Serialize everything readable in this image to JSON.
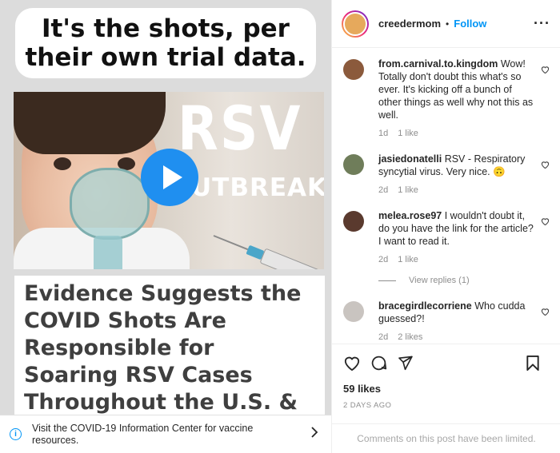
{
  "post": {
    "caption_overlay": "It's the shots, per their own trial data.",
    "image_title_main": "RSV",
    "image_title_sub": "UTBREAK",
    "headline": "Evidence Suggests the COVID Shots Are Responsible for Soaring RSV Cases Throughout the U.S. & Canada",
    "info_banner": "Visit the COVID-19 Information Center for vaccine resources."
  },
  "header": {
    "username": "creedermom",
    "separator": "•",
    "follow_label": "Follow",
    "more_label": "···"
  },
  "comments": [
    {
      "user": "from.carnival.to.kingdom",
      "text": "Wow! Totally don't doubt this what's so ever. It's kicking off a bunch of other things as well why not this as well.",
      "age": "1d",
      "likes": "1 like",
      "avatar_color": "#8b5a3c"
    },
    {
      "user": "jasiedonatelli",
      "text": "RSV - Respiratory syncytial virus. Very nice. 🙃",
      "age": "2d",
      "likes": "1 like",
      "avatar_color": "#6f7d5a"
    },
    {
      "user": "melea.rose97",
      "text": "I wouldn't doubt it, do you have the link for the article? I want to read it.",
      "age": "2d",
      "likes": "1 like",
      "avatar_color": "#5a3a2e"
    },
    {
      "user": "bracegirdlecorriene",
      "text": "Who cudda guessed?!",
      "age": "2d",
      "likes": "2 likes",
      "avatar_color": "#c9c4c0"
    }
  ],
  "view_replies_label": "View replies (1)",
  "likes_count": "59 likes",
  "post_date": "2 DAYS AGO",
  "comments_limited": "Comments on this post have been limited.",
  "colors": {
    "accent": "#0095f6",
    "play_button": "#1f8ff0"
  }
}
